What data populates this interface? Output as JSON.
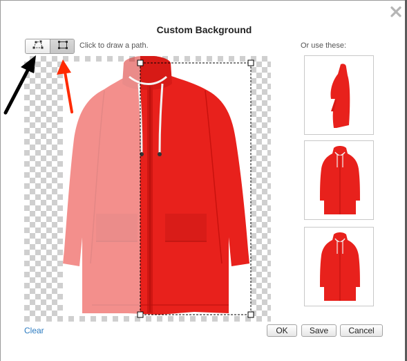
{
  "dialog": {
    "title": "Custom Background",
    "close_icon": "close-x-icon"
  },
  "toolbar": {
    "tools": [
      {
        "name": "path-tool",
        "icon": "polygon-path-icon",
        "selected": false
      },
      {
        "name": "rectangle-tool",
        "icon": "rectangle-select-icon",
        "selected": true
      }
    ],
    "hint": "Click to draw a path."
  },
  "alternatives": {
    "label": "Or use these:",
    "thumbnails": [
      {
        "icon": "red-raincoat-side-view"
      },
      {
        "icon": "red-raincoat-front-view"
      },
      {
        "icon": "red-raincoat-front-view"
      }
    ]
  },
  "footer": {
    "clear_label": "Clear",
    "ok_label": "OK",
    "save_label": "Save",
    "cancel_label": "Cancel"
  },
  "annotations": {
    "arrow_colors": [
      "#000000",
      "#ff2a00"
    ]
  },
  "colors": {
    "coat_red": "#e8211c",
    "link_blue": "#2a7ac0"
  }
}
